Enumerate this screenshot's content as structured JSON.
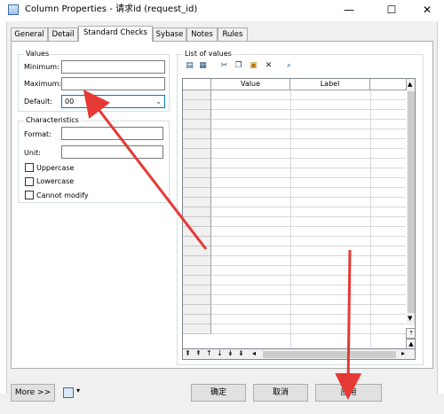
{
  "window": {
    "title": "Column Properties - 请求id (request_id)",
    "minimize": "—",
    "maximize": "☐",
    "close": "✕"
  },
  "tabs": [
    {
      "label": "General",
      "active": false
    },
    {
      "label": "Detail",
      "active": false
    },
    {
      "label": "Standard Checks",
      "active": true
    },
    {
      "label": "Sybase",
      "active": false
    },
    {
      "label": "Notes",
      "active": false
    },
    {
      "label": "Rules",
      "active": false
    }
  ],
  "values_group": {
    "legend": "Values",
    "minimum_label": "Minimum:",
    "minimum_value": "",
    "maximum_label": "Maximum:",
    "maximum_value": "",
    "default_label": "Default:",
    "default_value": "00"
  },
  "characteristics_group": {
    "legend": "Characteristics",
    "format_label": "Format:",
    "format_value": "",
    "unit_label": "Unit:",
    "unit_value": "",
    "uppercase_label": "Uppercase",
    "uppercase_checked": false,
    "lowercase_label": "Lowercase",
    "lowercase_checked": false,
    "cannot_modify_label": "Cannot modify",
    "cannot_modify_checked": false
  },
  "list_of_values": {
    "legend": "List of values",
    "toolbar_icons": [
      "insert-row-icon",
      "add-row-icon",
      "cut-icon",
      "copy-icon",
      "paste-icon",
      "delete-icon",
      "find-icon"
    ],
    "columns": [
      "Value",
      "Label"
    ]
  },
  "footer": {
    "more_label": "More >>",
    "ok_label": "确定",
    "cancel_label": "取消",
    "apply_label": "应用"
  },
  "annotation": {
    "arrow_color": "#e53935"
  }
}
